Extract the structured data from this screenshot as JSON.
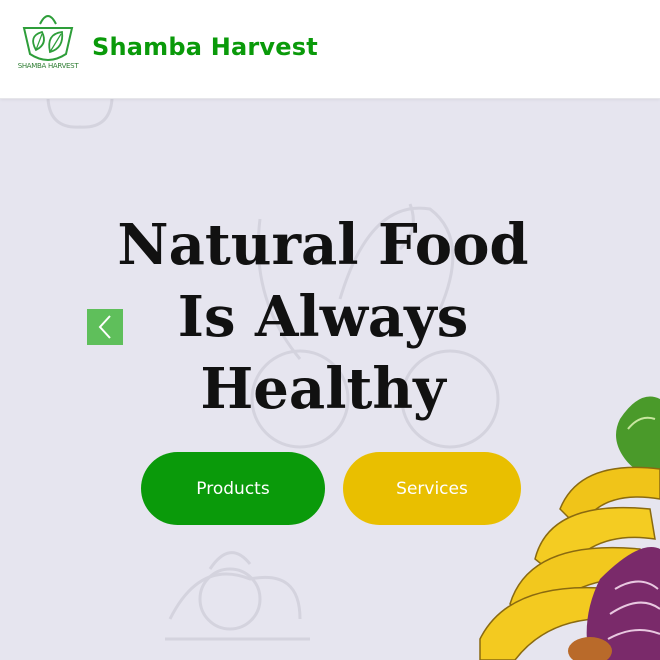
{
  "header": {
    "logo_caption": "SHAMBA HARVEST",
    "brand_name": "Shamba Harvest",
    "logo_icon": "basket-leaf-logo"
  },
  "hero": {
    "headline_lines": [
      "Natural Food",
      "Is Always",
      "Healthy"
    ],
    "prev_icon": "chevron-left-icon",
    "buttons": {
      "products_label": "Products",
      "services_label": "Services"
    }
  },
  "colors": {
    "brand_green": "#0a9a0a",
    "services_yellow": "#e9bf00",
    "arrow_green": "#5fbf5b",
    "hero_bg": "#e6e5ef"
  }
}
